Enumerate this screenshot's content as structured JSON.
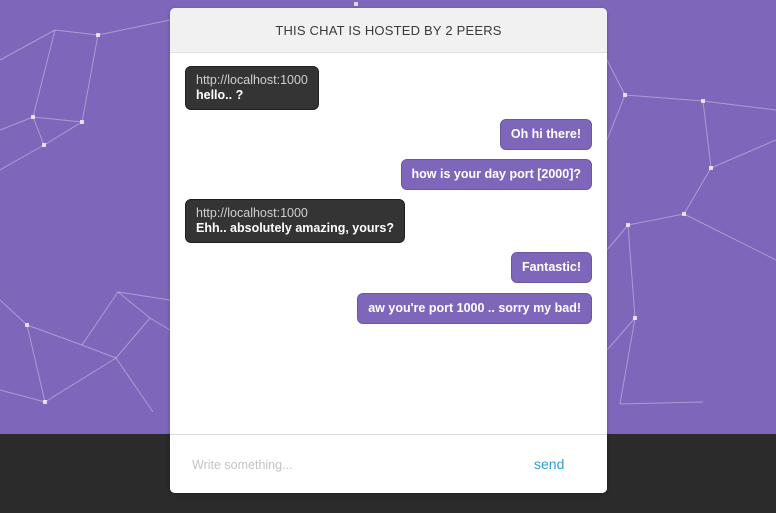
{
  "header": {
    "title": "THIS CHAT IS HOSTED BY 2 PEERS"
  },
  "messages": [
    {
      "direction": "in",
      "sender": "http://localhost:1000",
      "text": "hello.. ?"
    },
    {
      "direction": "out",
      "text": "Oh hi there!"
    },
    {
      "direction": "out",
      "text": "how is your day port [2000]?"
    },
    {
      "direction": "in",
      "sender": "http://localhost:1000",
      "text": "Ehh.. absolutely amazing, yours?"
    },
    {
      "direction": "out",
      "text": "Fantastic!"
    },
    {
      "direction": "out",
      "text": "aw you're port 1000 .. sorry my bad!"
    }
  ],
  "composer": {
    "placeholder": "Write something...",
    "value": "",
    "send_label": "send"
  },
  "colors": {
    "background": "#7e67bb",
    "footer": "#2b2b2b",
    "incoming_bubble": "#343434",
    "outgoing_bubble": "#7e67bb",
    "send_link": "#2a9fd8"
  }
}
